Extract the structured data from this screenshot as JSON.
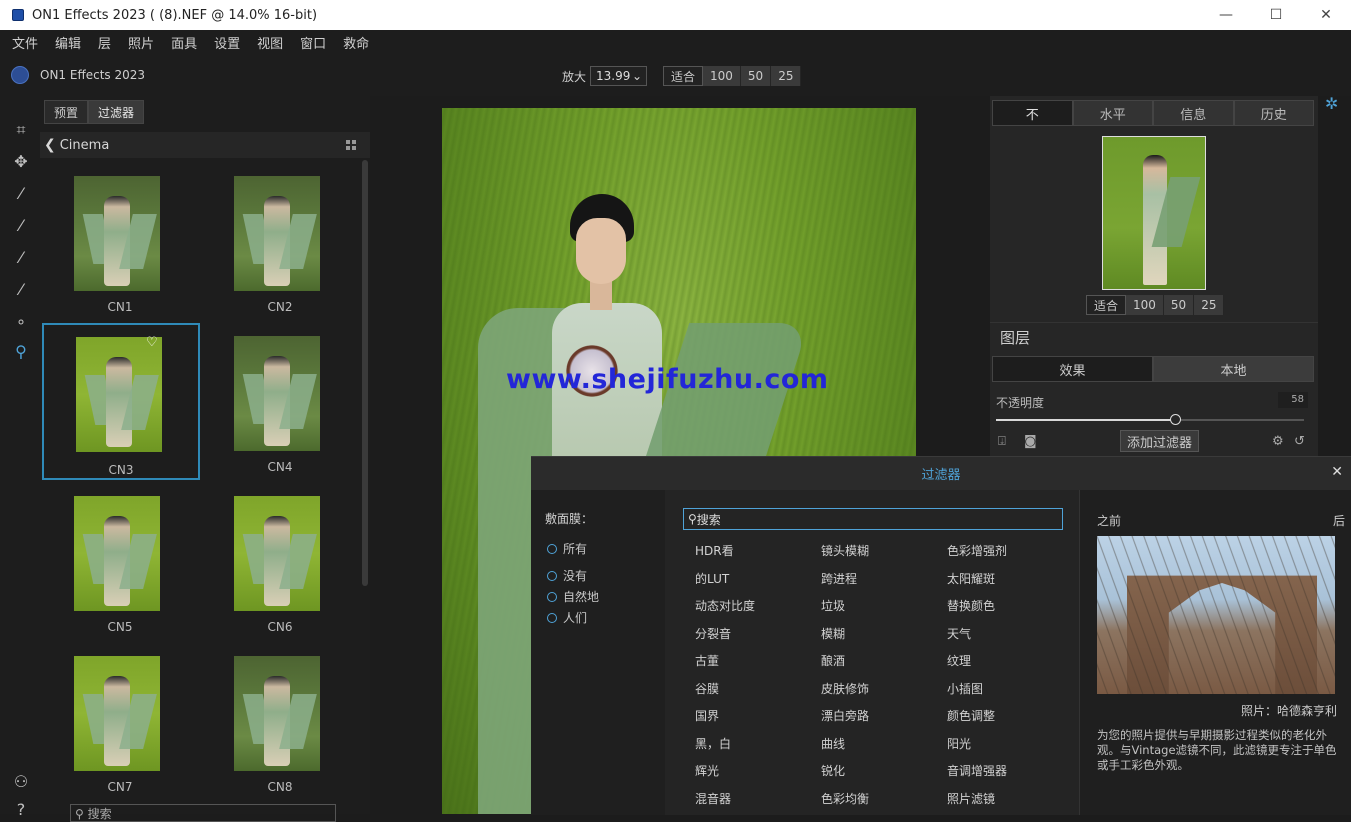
{
  "window": {
    "title": "ON1 Effects 2023 ( (8).NEF @ 14.0% 16-bit)",
    "min": "—",
    "max": "☐",
    "close": "✕"
  },
  "menu": [
    "文件",
    "编辑",
    "层",
    "照片",
    "面具",
    "设置",
    "视图",
    "窗口",
    "救命"
  ],
  "appbar": {
    "app_name": "ON1 Effects 2023",
    "zoom_label": "放大",
    "zoom_value": "13.99",
    "zoom_buttons": [
      "适合",
      "100",
      "50",
      "25"
    ]
  },
  "browser": {
    "tabs": [
      "预置",
      "过滤器"
    ],
    "folder": "Cinema",
    "thumbs": [
      "CN1",
      "CN2",
      "CN3",
      "CN4",
      "CN5",
      "CN6",
      "CN7",
      "CN8"
    ],
    "search_placeholder": "搜索"
  },
  "watermark": "www.shejifuzhu.com",
  "right_panel": {
    "tabs": [
      "不",
      "水平",
      "信息",
      "历史"
    ],
    "nav_zoom": [
      "适合",
      "100",
      "50",
      "25"
    ],
    "layers_title": "图层",
    "layer_tabs": [
      "效果",
      "本地"
    ],
    "opacity_label": "不透明度",
    "opacity_value": "58",
    "opacity_level": 0.58,
    "add_filter": "添加过滤器"
  },
  "dialog": {
    "title": "过滤器",
    "close": "✕",
    "left_header": "敷面膜：",
    "radios": [
      "所有",
      "没有",
      "自然地",
      "人们"
    ],
    "search": "搜索",
    "filters": [
      [
        "HDR看",
        "镜头模糊",
        "色彩增强剂"
      ],
      [
        "的LUT",
        "跨进程",
        "太阳耀斑"
      ],
      [
        "动态对比度",
        "垃圾",
        "替换颜色"
      ],
      [
        "分裂音",
        "模糊",
        "天气"
      ],
      [
        "古董",
        "酿酒",
        "纹理"
      ],
      [
        "谷膜",
        "皮肤修饰",
        "小插图"
      ],
      [
        "国界",
        "漂白旁路",
        "颜色调整"
      ],
      [
        "黑，白",
        "曲线",
        "阳光"
      ],
      [
        "辉光",
        "锐化",
        "音调增强器"
      ],
      [
        "混音器",
        "色彩均衡",
        "照片滤镜"
      ]
    ],
    "before": "之前",
    "after": "后",
    "credit": "照片：哈德森亨利",
    "description": "为您的照片提供与早期摄影过程类似的老化外观。与Vintage滤镜不同，此滤镜更专注于单色或手工彩色外观。"
  }
}
